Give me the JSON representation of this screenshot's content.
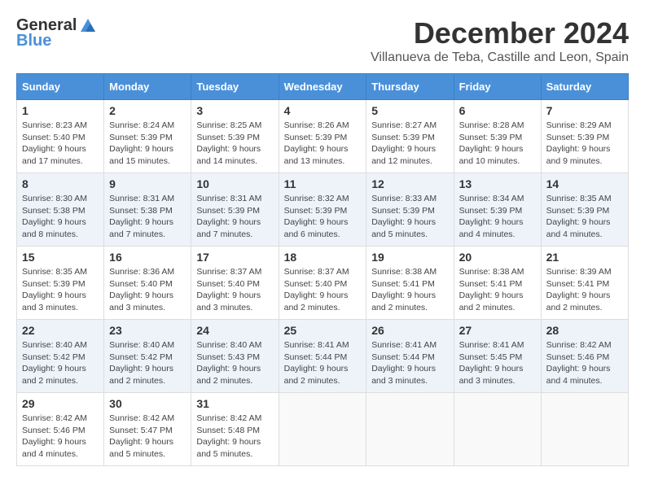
{
  "logo": {
    "general": "General",
    "blue": "Blue"
  },
  "title": "December 2024",
  "subtitle": "Villanueva de Teba, Castille and Leon, Spain",
  "headers": [
    "Sunday",
    "Monday",
    "Tuesday",
    "Wednesday",
    "Thursday",
    "Friday",
    "Saturday"
  ],
  "weeks": [
    [
      {
        "day": "1",
        "sunrise": "8:23 AM",
        "sunset": "5:40 PM",
        "daylight": "9 hours and 17 minutes."
      },
      {
        "day": "2",
        "sunrise": "8:24 AM",
        "sunset": "5:39 PM",
        "daylight": "9 hours and 15 minutes."
      },
      {
        "day": "3",
        "sunrise": "8:25 AM",
        "sunset": "5:39 PM",
        "daylight": "9 hours and 14 minutes."
      },
      {
        "day": "4",
        "sunrise": "8:26 AM",
        "sunset": "5:39 PM",
        "daylight": "9 hours and 13 minutes."
      },
      {
        "day": "5",
        "sunrise": "8:27 AM",
        "sunset": "5:39 PM",
        "daylight": "9 hours and 12 minutes."
      },
      {
        "day": "6",
        "sunrise": "8:28 AM",
        "sunset": "5:39 PM",
        "daylight": "9 hours and 10 minutes."
      },
      {
        "day": "7",
        "sunrise": "8:29 AM",
        "sunset": "5:39 PM",
        "daylight": "9 hours and 9 minutes."
      }
    ],
    [
      {
        "day": "8",
        "sunrise": "8:30 AM",
        "sunset": "5:38 PM",
        "daylight": "9 hours and 8 minutes."
      },
      {
        "day": "9",
        "sunrise": "8:31 AM",
        "sunset": "5:38 PM",
        "daylight": "9 hours and 7 minutes."
      },
      {
        "day": "10",
        "sunrise": "8:31 AM",
        "sunset": "5:39 PM",
        "daylight": "9 hours and 7 minutes."
      },
      {
        "day": "11",
        "sunrise": "8:32 AM",
        "sunset": "5:39 PM",
        "daylight": "9 hours and 6 minutes."
      },
      {
        "day": "12",
        "sunrise": "8:33 AM",
        "sunset": "5:39 PM",
        "daylight": "9 hours and 5 minutes."
      },
      {
        "day": "13",
        "sunrise": "8:34 AM",
        "sunset": "5:39 PM",
        "daylight": "9 hours and 4 minutes."
      },
      {
        "day": "14",
        "sunrise": "8:35 AM",
        "sunset": "5:39 PM",
        "daylight": "9 hours and 4 minutes."
      }
    ],
    [
      {
        "day": "15",
        "sunrise": "8:35 AM",
        "sunset": "5:39 PM",
        "daylight": "9 hours and 3 minutes."
      },
      {
        "day": "16",
        "sunrise": "8:36 AM",
        "sunset": "5:40 PM",
        "daylight": "9 hours and 3 minutes."
      },
      {
        "day": "17",
        "sunrise": "8:37 AM",
        "sunset": "5:40 PM",
        "daylight": "9 hours and 3 minutes."
      },
      {
        "day": "18",
        "sunrise": "8:37 AM",
        "sunset": "5:40 PM",
        "daylight": "9 hours and 2 minutes."
      },
      {
        "day": "19",
        "sunrise": "8:38 AM",
        "sunset": "5:41 PM",
        "daylight": "9 hours and 2 minutes."
      },
      {
        "day": "20",
        "sunrise": "8:38 AM",
        "sunset": "5:41 PM",
        "daylight": "9 hours and 2 minutes."
      },
      {
        "day": "21",
        "sunrise": "8:39 AM",
        "sunset": "5:41 PM",
        "daylight": "9 hours and 2 minutes."
      }
    ],
    [
      {
        "day": "22",
        "sunrise": "8:40 AM",
        "sunset": "5:42 PM",
        "daylight": "9 hours and 2 minutes."
      },
      {
        "day": "23",
        "sunrise": "8:40 AM",
        "sunset": "5:42 PM",
        "daylight": "9 hours and 2 minutes."
      },
      {
        "day": "24",
        "sunrise": "8:40 AM",
        "sunset": "5:43 PM",
        "daylight": "9 hours and 2 minutes."
      },
      {
        "day": "25",
        "sunrise": "8:41 AM",
        "sunset": "5:44 PM",
        "daylight": "9 hours and 2 minutes."
      },
      {
        "day": "26",
        "sunrise": "8:41 AM",
        "sunset": "5:44 PM",
        "daylight": "9 hours and 3 minutes."
      },
      {
        "day": "27",
        "sunrise": "8:41 AM",
        "sunset": "5:45 PM",
        "daylight": "9 hours and 3 minutes."
      },
      {
        "day": "28",
        "sunrise": "8:42 AM",
        "sunset": "5:46 PM",
        "daylight": "9 hours and 4 minutes."
      }
    ],
    [
      {
        "day": "29",
        "sunrise": "8:42 AM",
        "sunset": "5:46 PM",
        "daylight": "9 hours and 4 minutes."
      },
      {
        "day": "30",
        "sunrise": "8:42 AM",
        "sunset": "5:47 PM",
        "daylight": "9 hours and 5 minutes."
      },
      {
        "day": "31",
        "sunrise": "8:42 AM",
        "sunset": "5:48 PM",
        "daylight": "9 hours and 5 minutes."
      },
      null,
      null,
      null,
      null
    ]
  ]
}
